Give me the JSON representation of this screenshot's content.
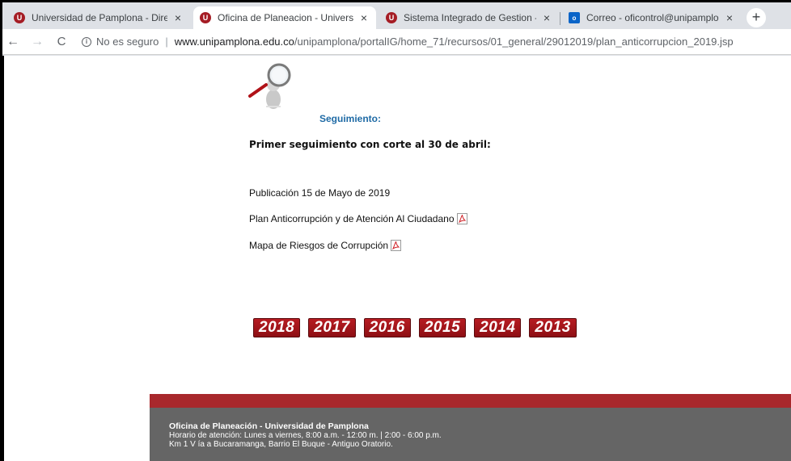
{
  "tabs": [
    {
      "icon": "university-favicon",
      "label": "Universidad de Pamplona - Direc",
      "active": false
    },
    {
      "icon": "university-favicon",
      "label": "Oficina de Planeacion - Universid",
      "active": true
    },
    {
      "icon": "university-favicon",
      "label": "Sistema Integrado de Gestion - U",
      "active": false
    },
    {
      "icon": "outlook-favicon",
      "label": "Correo - oficontrol@unipamplon",
      "active": false
    }
  ],
  "tab_favicon_text": "U",
  "outlook_favicon_text": "o",
  "close_glyph": "×",
  "new_tab_glyph": "+",
  "address": {
    "security_label": "No es seguro",
    "domain": "www.unipamplona.edu.co",
    "path": "/unipamplona/portalIG/home_71/recursos/01_general/29012019/plan_anticorrupcion_2019.jsp"
  },
  "content": {
    "seguimiento_title": "Seguimiento:",
    "primer_seguimiento": "Primer seguimiento con corte al 30 de abril:",
    "publicacion": "Publicación 15 de Mayo de 2019",
    "plan_link": "Plan Anticorrupción y de Atención Al Ciudadano",
    "mapa_link": "Mapa de Riesgos de Corrupción"
  },
  "years": [
    "2018",
    "2017",
    "2016",
    "2015",
    "2014",
    "2013"
  ],
  "footer": {
    "title": "Oficina de Planeación - Universidad de Pamplona",
    "hours": "Horario de atención: Lunes a viernes, 8:00 a.m. - 12:00 m. | 2:00 - 6:00 p.m.",
    "address": "Km 1 V ía a Bucaramanga, Barrio El Buque  - Antiguo Oratorio."
  },
  "colors": {
    "brand_red": "#a8282c",
    "footer_gray": "#656565",
    "link_blue": "#1e6aa5"
  }
}
